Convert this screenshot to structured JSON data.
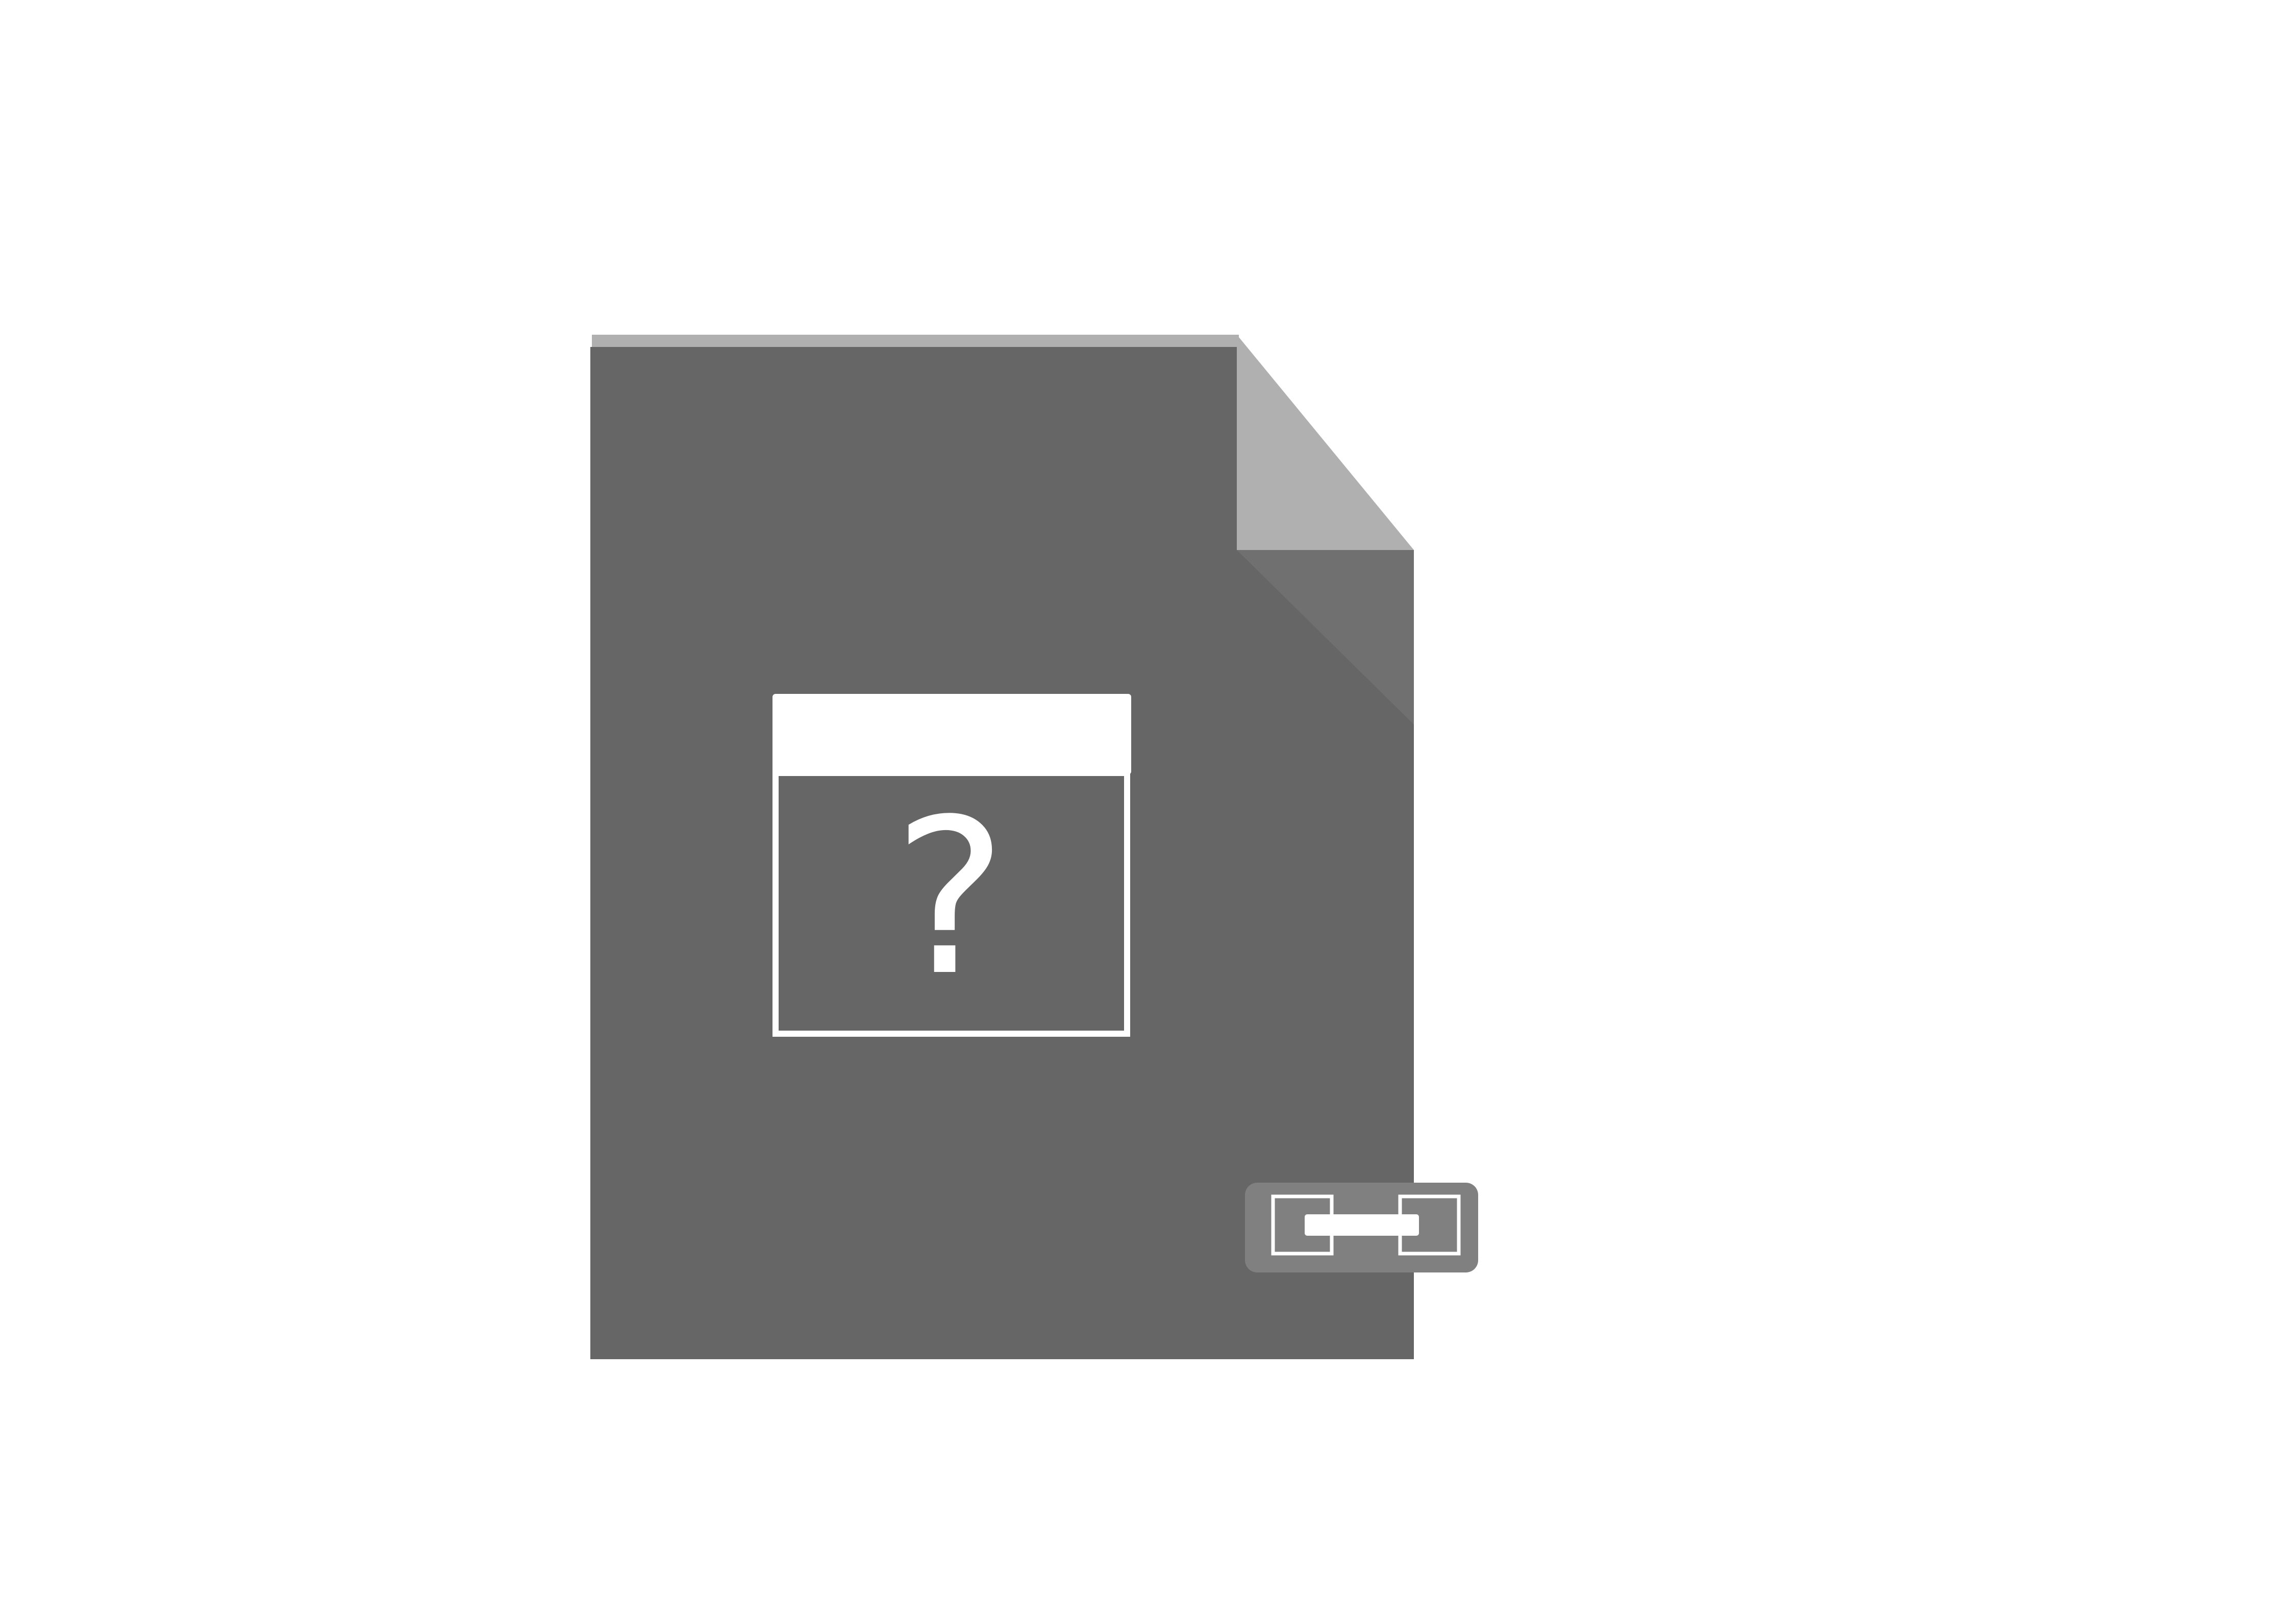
{
  "icon": {
    "name": "unknown-application-link-file-icon",
    "window_glyph": "?",
    "badge": "link-icon"
  },
  "colors": {
    "background": "#ffffff",
    "document_body": "#666666",
    "document_top_edge": "#b0b0b0",
    "folded_corner": "#b0b0b0",
    "corner_shadow": "#707070",
    "window_outline": "#ffffff",
    "glyph": "#ffffff",
    "link_badge": "#808080",
    "link_chain": "#ffffff"
  }
}
